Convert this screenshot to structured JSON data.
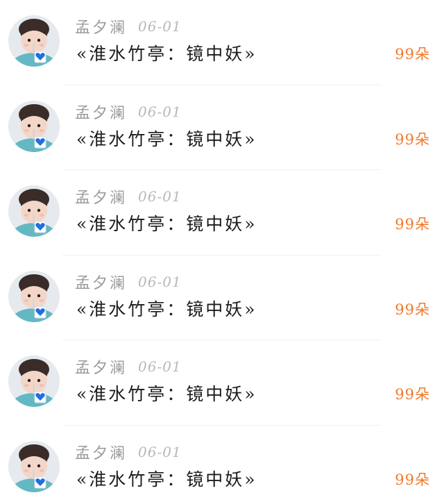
{
  "items": [
    {
      "author": "孟夕澜",
      "date": "06-01",
      "title": "«淮水竹亭：镜中妖»",
      "count": "99朵",
      "avatar_icon": "child-with-blue-heart-avatar"
    },
    {
      "author": "孟夕澜",
      "date": "06-01",
      "title": "«淮水竹亭：镜中妖»",
      "count": "99朵",
      "avatar_icon": "child-with-blue-heart-avatar"
    },
    {
      "author": "孟夕澜",
      "date": "06-01",
      "title": "«淮水竹亭：镜中妖»",
      "count": "99朵",
      "avatar_icon": "child-with-blue-heart-avatar"
    },
    {
      "author": "孟夕澜",
      "date": "06-01",
      "title": "«淮水竹亭：镜中妖»",
      "count": "99朵",
      "avatar_icon": "child-with-blue-heart-avatar"
    },
    {
      "author": "孟夕澜",
      "date": "06-01",
      "title": "«淮水竹亭：镜中妖»",
      "count": "99朵",
      "avatar_icon": "child-with-blue-heart-avatar"
    },
    {
      "author": "孟夕澜",
      "date": "06-01",
      "title": "«淮水竹亭：镜中妖»",
      "count": "99朵",
      "avatar_icon": "child-with-blue-heart-avatar"
    }
  ],
  "colors": {
    "accent": "#f07a2a",
    "author": "#9b9b9b",
    "date": "#b8b8b8",
    "title": "#1c1c1c"
  }
}
